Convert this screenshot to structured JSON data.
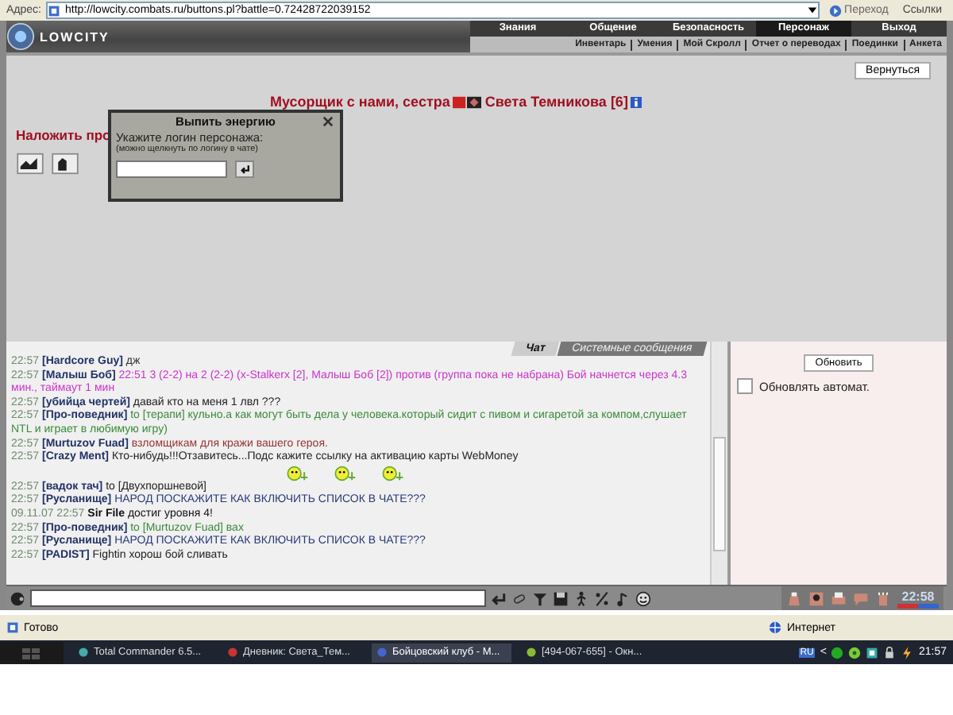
{
  "address_bar": {
    "label": "Адрес:",
    "url": "http://lowcity.combats.ru/buttons.pl?battle=0.72428722039152",
    "go": "Переход",
    "links": "Ссылки"
  },
  "header": {
    "logo": "LOWCITY",
    "menu": [
      {
        "label": "Знания",
        "selected": false
      },
      {
        "label": "Общение",
        "selected": false
      },
      {
        "label": "Безопасность",
        "selected": false
      },
      {
        "label": "Персонаж",
        "selected": true
      },
      {
        "label": "Выход",
        "selected": false
      }
    ],
    "submenu": [
      "Инвентарь",
      "Умения",
      "Мой Скролл",
      "Отчет о переводах",
      "Поединки",
      "Анкета"
    ]
  },
  "main": {
    "back_button": "Вернуться",
    "title_prefix": "Мусорщик с нами, сестра",
    "title_name": "Света Темникова [6]",
    "spell_label": "Наложить про"
  },
  "dialog": {
    "title": "Выпить энергию",
    "prompt": "Укажите логин персонажа:",
    "hint": "(можно щелкнуть по логину в чате)"
  },
  "chat": {
    "tabs": [
      {
        "label": "Чат",
        "selected": true
      },
      {
        "label": "Системные сообщения",
        "selected": false
      }
    ],
    "messages": [
      {
        "kind": "message",
        "time": "22:57",
        "nick": "[Hardcore Guy]",
        "text": "дж",
        "color": "#333333"
      },
      {
        "kind": "message",
        "time": "22:57",
        "nick": "[Малыш Боб]",
        "text": "22:51 3 (2-2) на 2 (2-2) (x-Stalkerx [2], Малыш Боб [2]) против (группа пока не набрана) Бой начнется через 4.3 мин., таймаут 1 мин",
        "color": "#cc33cc"
      },
      {
        "kind": "message",
        "time": "22:57",
        "nick": "[убийца чертей]",
        "text": "давай кто на меня 1 лвл ???",
        "color": "#222222"
      },
      {
        "kind": "message",
        "time": "22:57",
        "nick": "[Про-поведник]",
        "text": "to [терапи] кульно.а как могут быть дела у человека.который сидит с пивом и сигаретой за компом,слушает NTL и играет в любимую игру)",
        "color": "#3a8a3a"
      },
      {
        "kind": "message",
        "time": "22:57",
        "nick": "[Murtuzov Fuad]",
        "text": "взломщикам для кражи вашего героя.",
        "color": "#993333"
      },
      {
        "kind": "message",
        "time": "22:57",
        "nick": "[Crazy Ment]",
        "text": "Кто-нибудь!!!Отзавитесь...Подс кажите ссылку на активацию карты WebMoney",
        "color": "#222222"
      },
      {
        "kind": "smileys"
      },
      {
        "kind": "message",
        "time": "22:57",
        "nick": "[вадок тач]",
        "text": "to [Двухпоршневой]",
        "color": "#222222"
      },
      {
        "kind": "message",
        "time": "22:57",
        "nick": "[Русланище]",
        "text": "НАРОД ПОСКАЖИТЕ КАК ВКЛЮЧИТЬ СПИСОК В ЧАТЕ???",
        "color": "#2a3a7a"
      },
      {
        "kind": "system",
        "date": "09.11.07",
        "time": "22:57",
        "nick": "Sir File",
        "text": "достиг уровня 4!"
      },
      {
        "kind": "message",
        "time": "22:57",
        "nick": "[Про-поведник]",
        "text": "to [Murtuzov Fuad] вах",
        "color": "#3a8a3a"
      },
      {
        "kind": "message",
        "time": "22:57",
        "nick": "[Русланище]",
        "text": "НАРОД ПОСКАЖИТЕ КАК ВКЛЮЧИТЬ СПИСОК В ЧАТЕ???",
        "color": "#2a3a7a"
      },
      {
        "kind": "message",
        "time": "22:57",
        "nick": "[PADIST]",
        "text": "Fightin хорош бой сливать",
        "color": "#222222"
      }
    ]
  },
  "side_panel": {
    "refresh_button": "Обновить",
    "auto_refresh": {
      "label": "Обновлять автомат.",
      "checked": false
    }
  },
  "toolbar": {
    "clock": "22:58"
  },
  "status_bar": {
    "status": "Готово",
    "zone": "Интернет"
  },
  "taskbar": {
    "items": [
      {
        "label": "Total Commander 6.5...",
        "selected": false
      },
      {
        "label": "Дневник: Света_Тем...",
        "selected": false
      },
      {
        "label": "Бойцовский клуб - М...",
        "selected": true
      },
      {
        "label": "[494-067-655] - Окн...",
        "selected": false
      }
    ],
    "language": "RU",
    "tray_arrow": "<",
    "clock": "21:57"
  }
}
